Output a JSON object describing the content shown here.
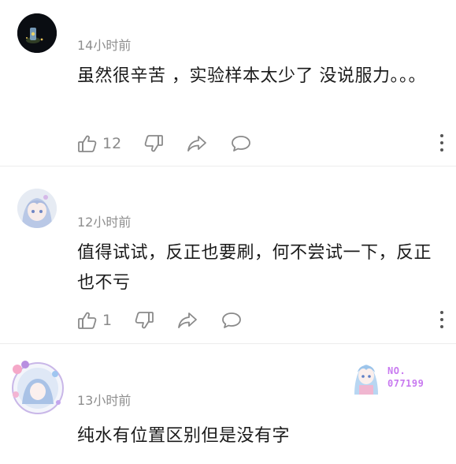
{
  "comments": [
    {
      "time": "14小时前",
      "text": "虽然很辛苦 ，实验样本太少了 没说服力。。。",
      "likes": "12"
    },
    {
      "time": "12小时前",
      "text": "值得试试，反正也要刷，何不尝试一下，反正也不亏",
      "likes": "1"
    },
    {
      "time": "13小时前",
      "text": "纯水有位置区别但是没有字",
      "badge": {
        "line1": "NO.",
        "line2": "077199"
      }
    }
  ],
  "colors": {
    "time": "#8e8e8e",
    "icon": "#8a8a8a",
    "badge": "#c879f0",
    "divider": "#ececec"
  },
  "icons": [
    "thumbs-up-icon",
    "thumbs-down-icon",
    "share-icon",
    "reply-bubble-icon",
    "more-dots-icon"
  ]
}
